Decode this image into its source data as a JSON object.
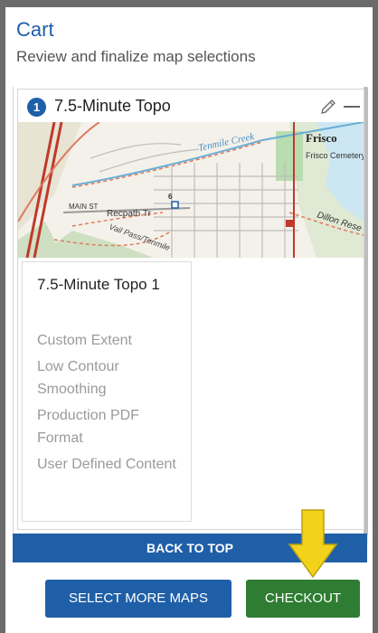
{
  "cart": {
    "title": "Cart",
    "subtitle": "Review and finalize map selections"
  },
  "item": {
    "number": "1",
    "title": "7.5-Minute Topo",
    "detail_title": "7.5-Minute Topo 1",
    "options": [
      "Custom Extent",
      "Low Contour Smoothing",
      "Production PDF Format",
      "User Defined Content"
    ]
  },
  "map_labels": {
    "creek": "Tenmile Creek",
    "town": "Frisco",
    "cemetery": "Frisco Cemetery",
    "main_st": "MAIN ST",
    "recpath": "Recpath Tr",
    "vail_pass": "Vail Pass/Tenmile",
    "dillon": "Dillon Rese",
    "route": "6"
  },
  "buttons": {
    "back_to_top": "BACK TO TOP",
    "select_more": "SELECT MORE MAPS",
    "checkout": "CHECKOUT"
  },
  "colors": {
    "accent": "#1f5fa8",
    "checkout": "#2e7d32",
    "arrow": "#f2d21b"
  },
  "icons": [
    "pencil-icon",
    "minus-icon",
    "arrow-down-icon"
  ]
}
